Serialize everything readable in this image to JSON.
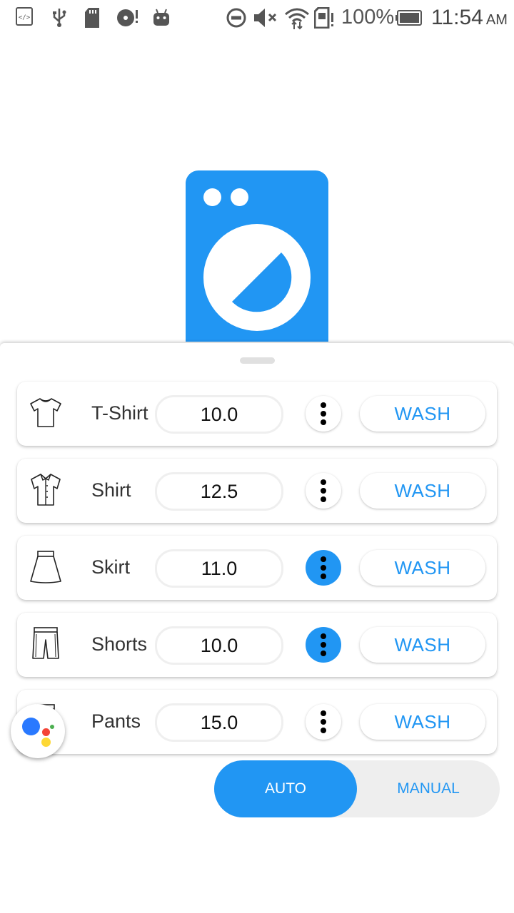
{
  "status_bar": {
    "battery_percent": "100%",
    "time": "11:54",
    "ampm": "AM",
    "icons": [
      "developer-icon",
      "usb-icon",
      "sd-card-icon",
      "disc-alert-icon",
      "android-icon",
      "dnd-icon",
      "mute-icon",
      "wifi-icon",
      "sim-alert-icon",
      "battery-icon"
    ]
  },
  "accent_color": "#2196f3",
  "garments": [
    {
      "name": "T-Shirt",
      "value": "10.0",
      "icon": "tshirt-icon",
      "menu_active": false,
      "action": "WASH"
    },
    {
      "name": "Shirt",
      "value": "12.5",
      "icon": "shirt-icon",
      "menu_active": false,
      "action": "WASH"
    },
    {
      "name": "Skirt",
      "value": "11.0",
      "icon": "skirt-icon",
      "menu_active": true,
      "action": "WASH"
    },
    {
      "name": "Shorts",
      "value": "10.0",
      "icon": "shorts-icon",
      "menu_active": true,
      "action": "WASH"
    },
    {
      "name": "Pants",
      "value": "15.0",
      "icon": "pants-icon",
      "menu_active": false,
      "action": "WASH"
    }
  ],
  "mode_toggle": {
    "options": [
      "AUTO",
      "MANUAL"
    ],
    "selected": "AUTO"
  }
}
